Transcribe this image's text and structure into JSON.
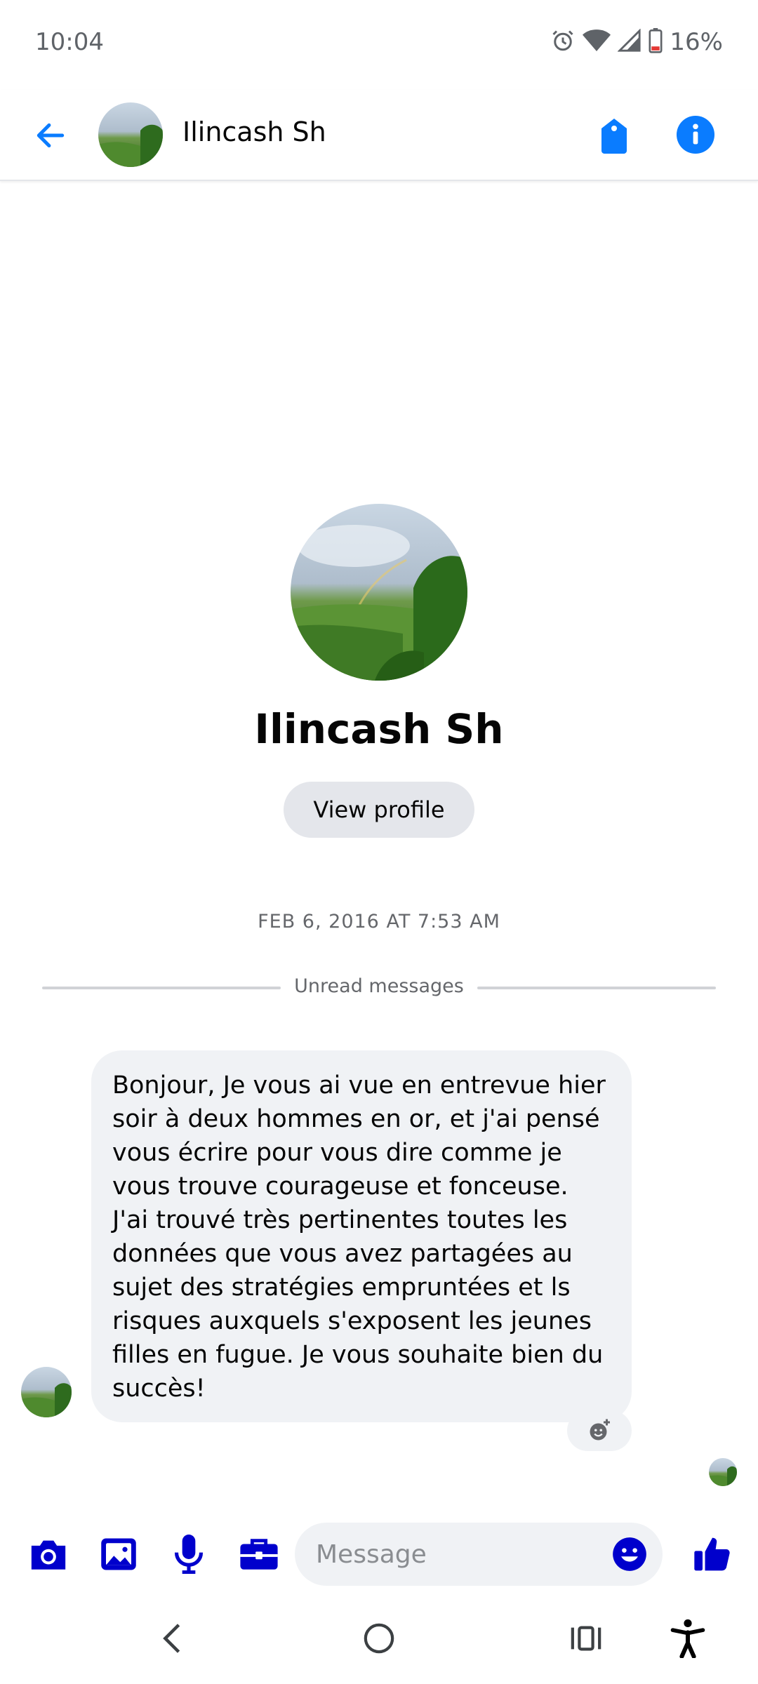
{
  "status_bar": {
    "time": "10:04",
    "battery": "16%",
    "icons": [
      "alarm-icon",
      "wifi-icon",
      "signal-icon",
      "battery-icon"
    ]
  },
  "header": {
    "contact_name": "Ilincash Sh",
    "icons": [
      "back-arrow-icon",
      "tag-icon",
      "info-icon"
    ]
  },
  "profile": {
    "name": "Ilincash Sh",
    "view_profile_label": "View profile"
  },
  "conversation": {
    "date": "FEB 6, 2016 AT 7:53 AM",
    "unread_label": "Unread messages",
    "messages": [
      {
        "text": "Bonjour, Je vous ai vue en entrevue hier soir à deux hommes en or, et j'ai pensé vous écrire pour vous dire comme je vous trouve courageuse et fonceuse. J'ai trouvé très pertinentes toutes les données que vous avez partagées au sujet des stratégies empruntées et ls risques auxquels s'exposent les jeunes filles en fugue. Je vous souhaite bien du succès!"
      }
    ]
  },
  "composer": {
    "placeholder": "Message",
    "icons": [
      "camera-icon",
      "gallery-icon",
      "microphone-icon",
      "briefcase-icon",
      "emoji-icon",
      "thumbs-up-icon"
    ]
  },
  "colors": {
    "accent_blue": "#0a7cff",
    "composer_icon": "#0000cc",
    "bubble_bg": "#f0f2f5"
  }
}
